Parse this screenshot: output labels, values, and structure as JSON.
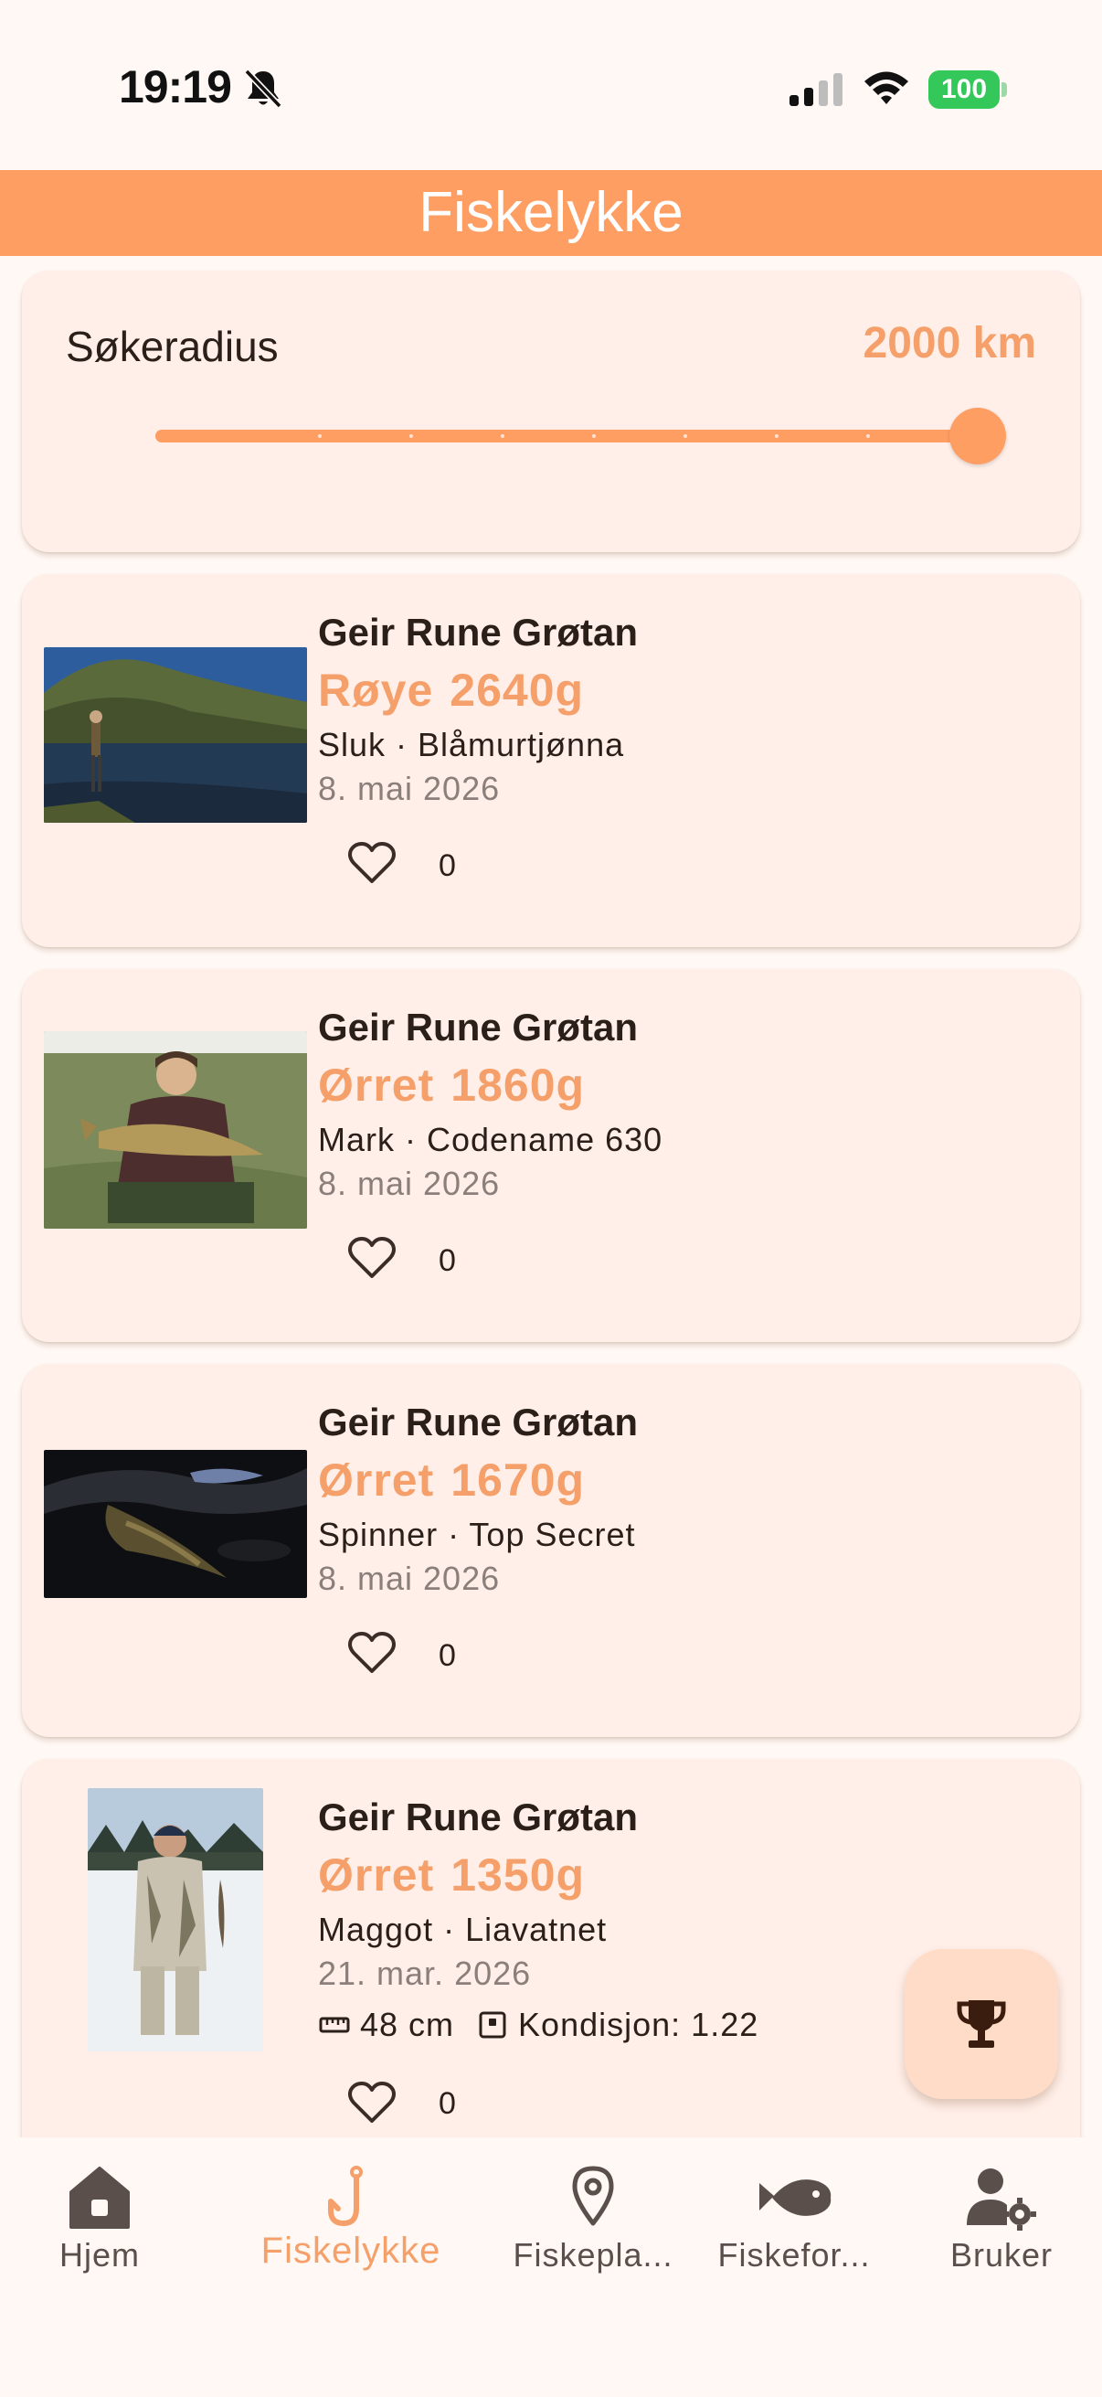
{
  "status_bar": {
    "time": "19:19",
    "battery": "100"
  },
  "app_bar": {
    "title": "Fiskelykke"
  },
  "radius": {
    "label": "Søkeradius",
    "value": "2000 km",
    "level": 1.0
  },
  "catches": [
    {
      "name": "Geir Rune Grøtan",
      "species": "Røye",
      "weight": "2640g",
      "meta": "Sluk · Blåmurtjønna",
      "date": "8. mai 2026",
      "likes": "0"
    },
    {
      "name": "Geir Rune Grøtan",
      "species": "Ørret",
      "weight": "1860g",
      "meta": "Mark · Codename 630",
      "date": "8. mai 2026",
      "likes": "0"
    },
    {
      "name": "Geir Rune Grøtan",
      "species": "Ørret",
      "weight": "1670g",
      "meta": "Spinner · Top Secret",
      "date": "8. mai 2026",
      "likes": "0"
    },
    {
      "name": "Geir Rune Grøtan",
      "species": "Ørret",
      "weight": "1350g",
      "meta": "Maggot · Liavatnet",
      "date": "21. mar. 2026",
      "length": "48 cm",
      "condition": "Kondisjon: 1.22",
      "likes": "0"
    }
  ],
  "fab": {
    "icon": "trophy-icon"
  },
  "nav": {
    "items": [
      {
        "label": "Hjem",
        "icon": "home-icon"
      },
      {
        "label": "Fiskelykke",
        "icon": "fishhook-icon",
        "active": true
      },
      {
        "label": "Fiskepla...",
        "icon": "location-pin-icon"
      },
      {
        "label": "Fiskefor...",
        "icon": "fish-icon"
      },
      {
        "label": "Bruker",
        "icon": "user-settings-icon"
      }
    ]
  },
  "colors": {
    "accent": "#FF9E63",
    "accent_text": "#F5A06A",
    "card": "#FFEFE8",
    "background": "#FFF8F4"
  }
}
